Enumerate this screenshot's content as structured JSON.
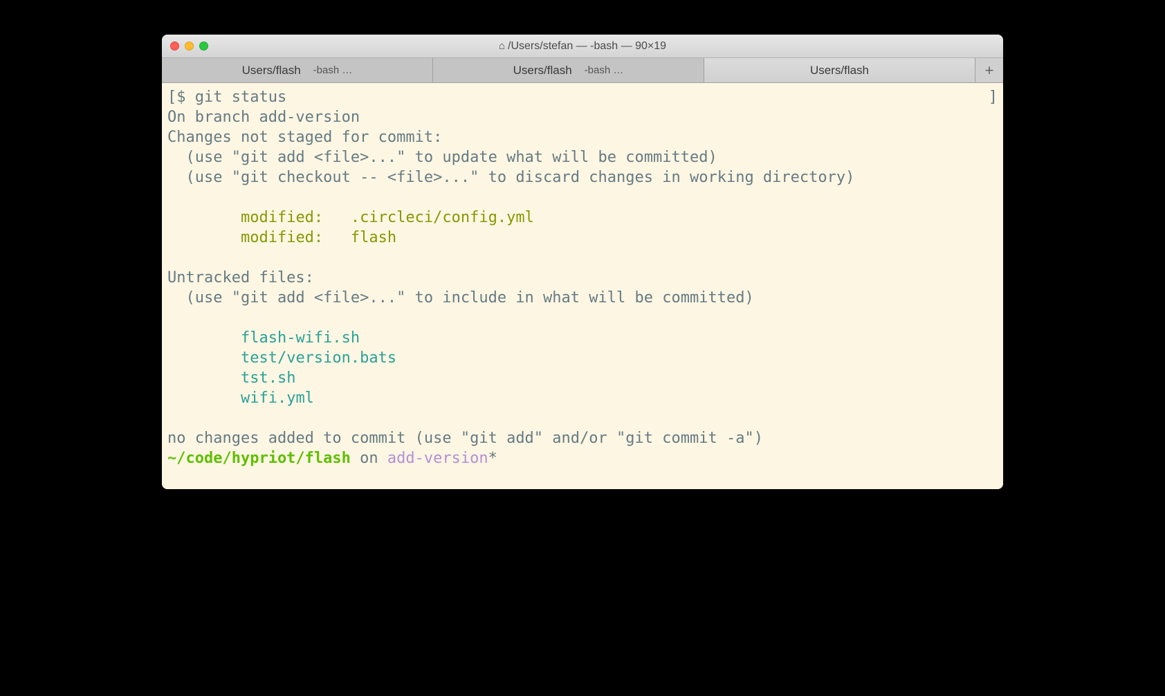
{
  "window": {
    "title": "/Users/stefan — -bash — 90×19",
    "home_icon": "⌂"
  },
  "tabs": [
    {
      "title": "Users/flash",
      "subtitle": "-bash …",
      "active": false
    },
    {
      "title": "Users/flash",
      "subtitle": "-bash …",
      "active": false
    },
    {
      "title": "Users/flash",
      "subtitle": "",
      "active": true
    }
  ],
  "new_tab_label": "+",
  "terminal": {
    "prompt_open": "[",
    "prompt_close": "]",
    "prompt_symbol": "$ ",
    "command": "git status",
    "branch_line": "On branch add-version",
    "changes_header": "Changes not staged for commit:",
    "hint1": "  (use \"git add <file>...\" to update what will be committed)",
    "hint2": "  (use \"git checkout -- <file>...\" to discard changes in working directory)",
    "modified_indent": "        ",
    "modified1_label": "modified:   ",
    "modified1_file": ".circleci/config.yml",
    "modified2_label": "modified:   ",
    "modified2_file": "flash",
    "untracked_header": "Untracked files:",
    "hint3": "  (use \"git add <file>...\" to include in what will be committed)",
    "untracked_indent": "        ",
    "untracked1": "flash-wifi.sh",
    "untracked2": "test/version.bats",
    "untracked3": "tst.sh",
    "untracked4": "wifi.yml",
    "no_changes": "no changes added to commit (use \"git add\" and/or \"git commit -a\")",
    "cwd": "~/code/hypriot/flash",
    "on_word": " on ",
    "branch_name": "add-version",
    "dirty_mark": "*"
  }
}
